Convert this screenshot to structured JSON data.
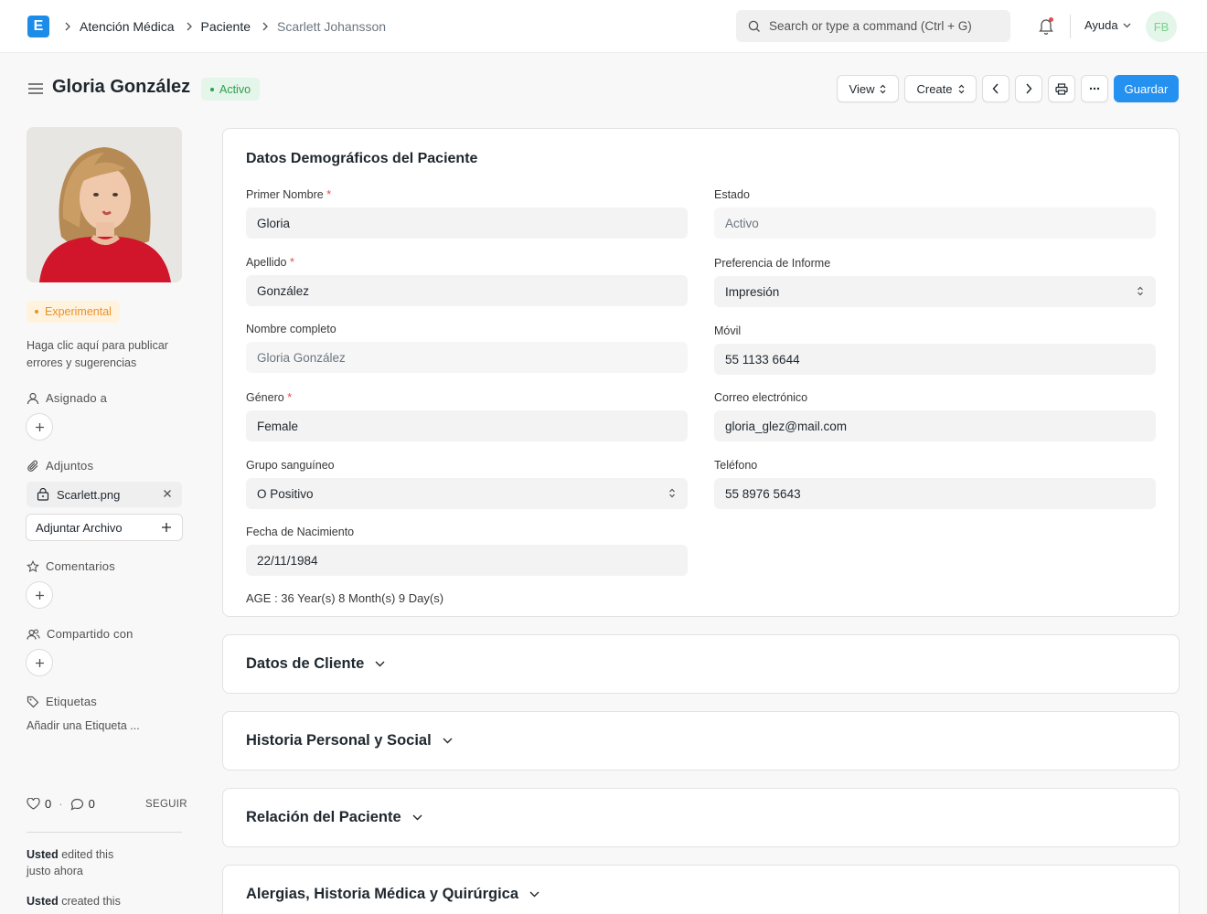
{
  "navbar": {
    "logo_letter": "E",
    "breadcrumbs": [
      "Atención Médica",
      "Paciente",
      "Scarlett Johansson"
    ],
    "search_placeholder": "Search or type a command (Ctrl + G)",
    "help_label": "Ayuda",
    "user_initials": "FB"
  },
  "header": {
    "title": "Gloria González",
    "status": "Activo",
    "buttons": {
      "view": "View",
      "create": "Create",
      "save": "Guardar"
    }
  },
  "sidebar": {
    "indicator": "Experimental",
    "feedback_text": "Haga clic aquí para publicar errores y sugerencias",
    "assigned_label": "Asignado a",
    "attachments_label": "Adjuntos",
    "attachment_file": "Scarlett.png",
    "attach_button": "Adjuntar Archivo",
    "comments_label": "Comentarios",
    "shared_label": "Compartido con",
    "tags_label": "Etiquetas",
    "add_tag": "Añadir una Etiqueta ...",
    "likes": "0",
    "comment_count": "0",
    "follow": "SEGUIR",
    "activity": [
      {
        "user": "Usted",
        "action": " edited this",
        "time": "justo ahora"
      },
      {
        "user": "Usted",
        "action": " created this",
        "time": ""
      }
    ]
  },
  "form": {
    "section_title": "Datos Demográficos del Paciente",
    "fields": {
      "first_name": {
        "label": "Primer Nombre",
        "value": "Gloria"
      },
      "last_name": {
        "label": "Apellido",
        "value": "González"
      },
      "full_name": {
        "label": "Nombre completo",
        "value": "Gloria González"
      },
      "gender": {
        "label": "Género",
        "value": "Female"
      },
      "blood_group": {
        "label": "Grupo sanguíneo",
        "value": "O Positivo"
      },
      "dob": {
        "label": "Fecha de Nacimiento",
        "value": "22/11/1984"
      },
      "status": {
        "label": "Estado",
        "value": "Activo"
      },
      "report_pref": {
        "label": "Preferencia de Informe",
        "value": "Impresión"
      },
      "mobile": {
        "label": "Móvil",
        "value": "55 1133 6644"
      },
      "email": {
        "label": "Correo electrónico",
        "value": "gloria_glez@mail.com"
      },
      "phone": {
        "label": "Teléfono",
        "value": "55 8976 5643"
      }
    },
    "age_text": "AGE : 36 Year(s) 8 Month(s) 9 Day(s)",
    "required_mark": "*"
  },
  "sections": [
    "Datos de Cliente",
    "Historia Personal y Social",
    "Relación del Paciente",
    "Alergias, Historia Médica y Quirúrgica"
  ]
}
